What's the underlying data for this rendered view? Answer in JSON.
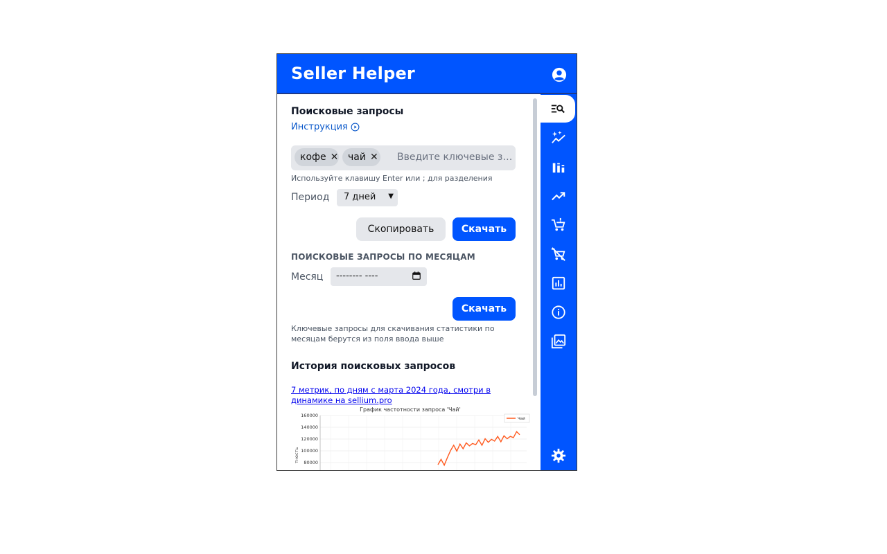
{
  "header": {
    "title": "Seller Helper",
    "account_icon": "account-circle-icon"
  },
  "colors": {
    "accent": "#0055ff",
    "chart_line": "#ff5a1f"
  },
  "search": {
    "title": "Поисковые запросы",
    "instruction_link": "Инструкция",
    "tags": [
      {
        "label": "кофе"
      },
      {
        "label": "чай"
      }
    ],
    "input_placeholder": "Введите ключевые запросы",
    "hint": "Используйте клавишу Enter или ; для разделения",
    "period_label": "Период",
    "period_value": "7 дней",
    "copy_button": "Скопировать",
    "download_button": "Скачать"
  },
  "monthly": {
    "title": "ПОИСКОВЫЕ ЗАПРОСЫ ПО МЕСЯЦАМ",
    "month_label": "Месяц",
    "month_value": "-------- ----",
    "download_button": "Скачать",
    "description": "Ключевые запросы для скачивания статистики по месяцам берутся из поля ввода выше"
  },
  "history": {
    "title": "История поисковых запросов",
    "promo_link": "7 метрик, по дням с марта 2024 года, смотри в динамике на sellium.pro"
  },
  "rail": {
    "items": [
      {
        "icon": "search-list-icon",
        "active": true
      },
      {
        "icon": "sparkle-trend-icon",
        "active": false
      },
      {
        "icon": "bar-stats-icon",
        "active": false
      },
      {
        "icon": "trending-up-icon",
        "active": false
      },
      {
        "icon": "cart-alert-icon",
        "active": false
      },
      {
        "icon": "cart-off-icon",
        "active": false
      },
      {
        "icon": "analytics-box-icon",
        "active": false
      },
      {
        "icon": "info-icon",
        "active": false
      },
      {
        "icon": "image-library-icon",
        "active": false
      }
    ],
    "settings_icon": "gear-icon"
  },
  "chart_data": {
    "type": "line",
    "title": "График частотности запроса 'Чай'",
    "ylabel": "тность",
    "yticks": [
      "160000",
      "140000",
      "120000",
      "100000",
      "80000"
    ],
    "ylim": [
      80000,
      160000
    ],
    "series": [
      {
        "name": "Чай",
        "values": [
          80000,
          82000,
          79000,
          85000,
          104000,
          106000,
          103000,
          108000,
          107000,
          110000,
          112000,
          109000,
          114000,
          115000,
          113000,
          117000,
          118000,
          116000,
          120000,
          121000,
          119000,
          122000,
          124000,
          121000,
          126000,
          129000,
          131000
        ]
      }
    ]
  }
}
